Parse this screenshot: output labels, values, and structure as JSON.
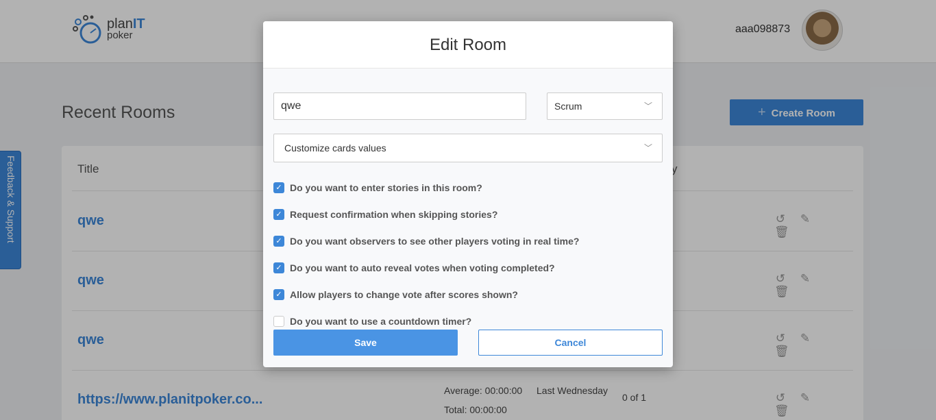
{
  "header": {
    "logo": {
      "plan": "plan",
      "it": "IT",
      "poker": "poker"
    },
    "username": "aaa098873"
  },
  "page": {
    "title": "Recent Rooms",
    "create_button": "Create Room",
    "columns": {
      "title": "Title",
      "partial": "y"
    },
    "rooms": [
      {
        "name": "qwe"
      },
      {
        "name": "qwe"
      },
      {
        "name": "qwe"
      },
      {
        "name": "https://www.planitpoker.co...",
        "average": "Average: 00:00:00",
        "total": "Total: 00:00:00",
        "last": "Last Wednesday",
        "count": "0 of 1"
      }
    ]
  },
  "feedback": "Feedback & Support",
  "modal": {
    "title": "Edit Room",
    "name_value": "qwe",
    "type_value": "Scrum",
    "cards_value": "Customize cards values",
    "options": [
      {
        "label": "Do you want to enter stories in this room?",
        "checked": true
      },
      {
        "label": "Request confirmation when skipping stories?",
        "checked": true
      },
      {
        "label": "Do you want observers to see other players voting in real time?",
        "checked": true
      },
      {
        "label": "Do you want to auto reveal votes when voting completed?",
        "checked": true
      },
      {
        "label": "Allow players to change vote after scores shown?",
        "checked": true
      },
      {
        "label": "Do you want to use a countdown timer?",
        "checked": false
      }
    ],
    "save": "Save",
    "cancel": "Cancel"
  },
  "colors": {
    "accent": "#3d87d8"
  }
}
